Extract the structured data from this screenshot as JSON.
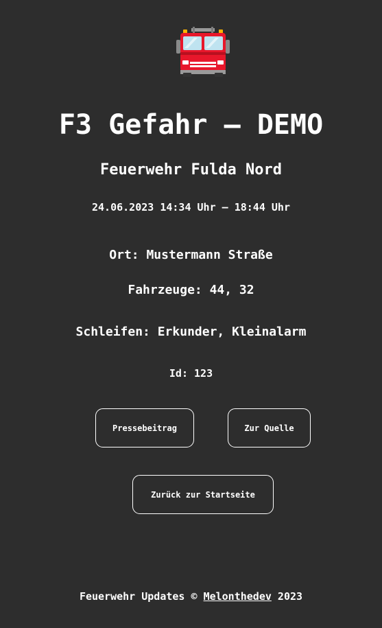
{
  "header": {
    "icon": "fire-truck-icon",
    "title": "F3 Gefahr – DEMO",
    "department": "Feuerwehr Fulda Nord",
    "time_range": "24.06.2023 14:34 Uhr – 18:44 Uhr"
  },
  "details": {
    "ort": "Ort: Mustermann Straße",
    "fahrzeuge": "Fahrzeuge: 44, 32",
    "schleifen": "Schleifen: Erkunder, Kleinalarm",
    "id": "Id: 123"
  },
  "buttons": {
    "presse": "Pressebeitrag",
    "quelle": "Zur Quelle",
    "back": "Zurück zur Startseite"
  },
  "footer": {
    "prefix": "Feuerwehr Updates © ",
    "link": "Melonthedev",
    "suffix": " 2023"
  },
  "colors": {
    "background": "#2d2d2d",
    "text": "#ffffff",
    "truck_red": "#e8172b"
  }
}
